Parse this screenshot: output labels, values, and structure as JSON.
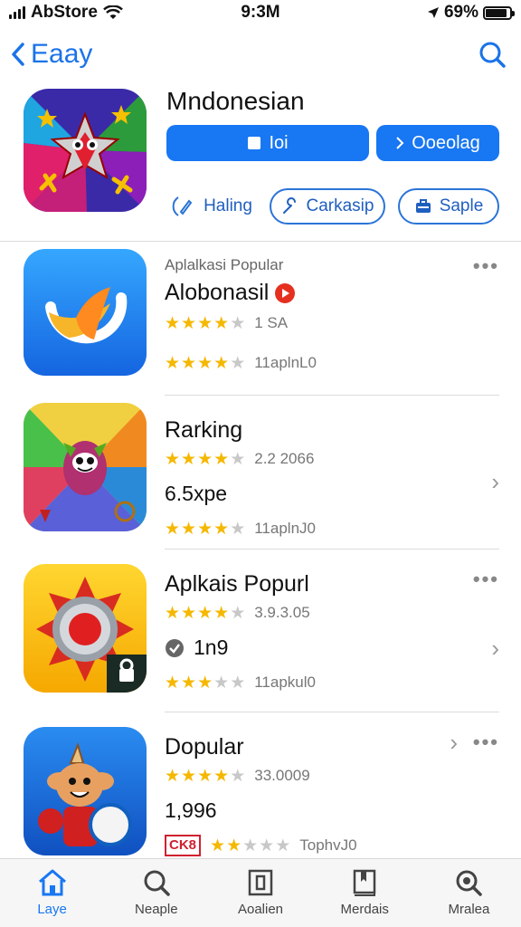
{
  "status": {
    "carrier": "AbStore",
    "time": "9:3M",
    "battery": "69%",
    "battery_level": 0.9
  },
  "nav": {
    "back_label": "Eaay"
  },
  "hero": {
    "title": "Mndonesian",
    "primary_btn_1": "Ioi",
    "primary_btn_2": "Ooeolag",
    "outline_btn_1": "Haling",
    "outline_btn_2": "Carkasip",
    "outline_btn_3": "Saple"
  },
  "apps": [
    {
      "category": "Aplalkasi Popular",
      "name": "Alobonasil",
      "rating_text": "1 SA",
      "rating1": 4.5,
      "downloads": "11aplnL0",
      "rating2": 4
    },
    {
      "name": "Rarking",
      "rating_text": "2.2 2066",
      "rating1": 4.5,
      "size": "6.5xpe",
      "downloads": "11aplnJ0",
      "rating2": 4
    },
    {
      "name": "Aplkais Popurl",
      "rating_text": "3.9.3.05",
      "rating1": 4.5,
      "size": "1n9",
      "downloads": "11apkul0",
      "rating2": 3.5
    },
    {
      "name": "Dopular",
      "rating_text": "33.0009",
      "rating1": 4,
      "size": "1,996",
      "downloads": "TophvJ0",
      "rating2": 2,
      "badge": "CK8"
    }
  ],
  "tabs": [
    "Laye",
    "Neaple",
    "Aoalien",
    "Merdais",
    "Mralea"
  ]
}
